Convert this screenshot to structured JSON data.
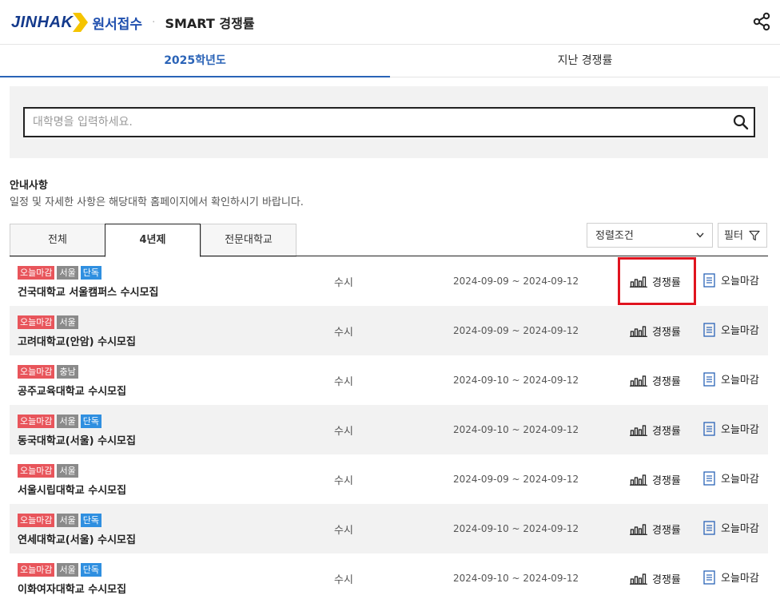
{
  "header": {
    "logo_text": "JINHAK",
    "brand_sub": "원서접수",
    "separator": "·",
    "title": "SMART 경쟁률",
    "icons": {
      "share": "share-icon"
    }
  },
  "year_tabs": [
    {
      "label": "2025학년도",
      "active": true
    },
    {
      "label": "지난 경쟁률",
      "active": false
    }
  ],
  "search": {
    "placeholder": "대학명을 입력하세요.",
    "value": ""
  },
  "notice": {
    "title": "안내사항",
    "text": "일정 및 자세한 사항은 해당대학 홈페이지에서 확인하시기 바랍니다."
  },
  "type_tabs": [
    {
      "label": "전체",
      "active": false
    },
    {
      "label": "4년제",
      "active": true
    },
    {
      "label": "전문대학교",
      "active": false
    }
  ],
  "sort": {
    "label": "정렬조건"
  },
  "filter": {
    "label": "필터"
  },
  "colors": {
    "accent": "#2a63b7",
    "badge_red": "#e8555b",
    "badge_gray": "#8a8a8a",
    "badge_blue": "#2f8fe0",
    "highlight": "#e0141f"
  },
  "rows": [
    {
      "badges": [
        "오늘마감",
        "서울",
        "단독"
      ],
      "name": "건국대학교 서울캠퍼스 수시모집",
      "kind": "수시",
      "period": "2024-09-09 ~ 2024-09-12",
      "comp_label": "경쟁률",
      "deadline_label": "오늘마감"
    },
    {
      "badges": [
        "오늘마감",
        "서울"
      ],
      "name": "고려대학교(안암) 수시모집",
      "kind": "수시",
      "period": "2024-09-09 ~ 2024-09-12",
      "comp_label": "경쟁률",
      "deadline_label": "오늘마감"
    },
    {
      "badges": [
        "오늘마감",
        "충남"
      ],
      "name": "공주교육대학교 수시모집",
      "kind": "수시",
      "period": "2024-09-10 ~ 2024-09-12",
      "comp_label": "경쟁률",
      "deadline_label": "오늘마감"
    },
    {
      "badges": [
        "오늘마감",
        "서울",
        "단독"
      ],
      "name": "동국대학교(서울) 수시모집",
      "kind": "수시",
      "period": "2024-09-10 ~ 2024-09-12",
      "comp_label": "경쟁률",
      "deadline_label": "오늘마감"
    },
    {
      "badges": [
        "오늘마감",
        "서울"
      ],
      "name": "서울시립대학교 수시모집",
      "kind": "수시",
      "period": "2024-09-09 ~ 2024-09-12",
      "comp_label": "경쟁률",
      "deadline_label": "오늘마감"
    },
    {
      "badges": [
        "오늘마감",
        "서울",
        "단독"
      ],
      "name": "연세대학교(서울) 수시모집",
      "kind": "수시",
      "period": "2024-09-10 ~ 2024-09-12",
      "comp_label": "경쟁률",
      "deadline_label": "오늘마감"
    },
    {
      "badges": [
        "오늘마감",
        "서울",
        "단독"
      ],
      "name": "이화여자대학교 수시모집",
      "kind": "수시",
      "period": "2024-09-10 ~ 2024-09-12",
      "comp_label": "경쟁률",
      "deadline_label": "오늘마감"
    }
  ]
}
